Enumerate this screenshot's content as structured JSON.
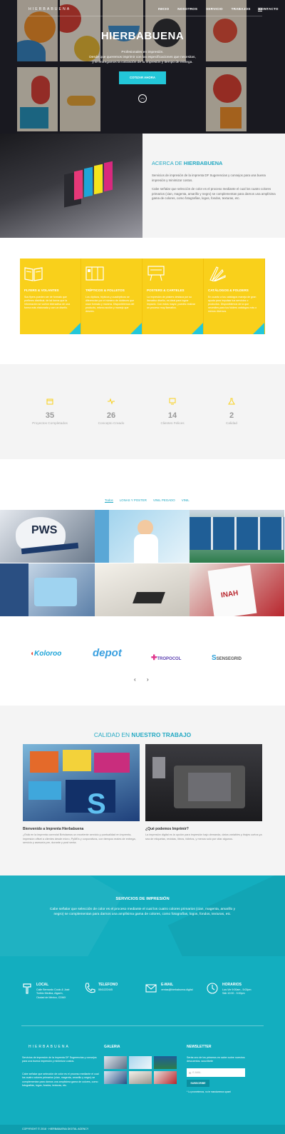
{
  "header": {
    "logo": "HIERBABUENA",
    "nav": [
      "INICIO",
      "NOSOTROS",
      "SERVICIO",
      "TRABAJOS",
      "CONTACTO"
    ]
  },
  "hero": {
    "title": "HIERBABUENA",
    "lines": [
      "Profesionales en impresión.",
      "Desde que queremos imprimir con las especificaciones que necesitas,",
      "y te entregamos la cotización de tu impresión y tiempo de entrega."
    ],
    "cta": "COTIZAR AHORA"
  },
  "about": {
    "title_prefix": "ACERCA DE",
    "title_brand": "HIERBABUENA",
    "p1": "Servicios de impresión de la imprenta DF Sugerencias y consejos para una buena impresión y minimizar costos.",
    "p2": "Cabe señalar que selección de color es el proceso mediante el cual los cuatro colores primarios (cian, magenta, amarillo y negro) se complementan para darnos una amplísima gama de colores, como fotografías, logos, fondos, texturas, etc."
  },
  "services": [
    {
      "title": "FLYERS & VOLANTES",
      "text": "Sus flyers pueden ser de formato que prefieres distribuir, de tal forma que la información se vuelve interactiva de una forma más elaborada y con un diseño."
    },
    {
      "title": "TRÍPTICOS & FOLLETOS",
      "text": "Los dípticos, trípticos y cuadrípticos se diferencian por el número de dobleces que usan formato y manera. Disponiblemos del producto, mismo acción y manejo que desees."
    },
    {
      "title": "POSTERS & CARTELES",
      "text": "La impresión de pósters destaca por su llamativo diseño, es ideal para lograr impacto. Con estos mayor, puedes realizar un proceso muy llamativo."
    },
    {
      "title": "CATÁLOGOS & FOLDERS",
      "text": "En cuanto a tus catálogos maneja de gran ayuda para impulsar tus servicios o productos. Disponiblemos de la que necesites para tus folders catálogos más o menos diversos."
    }
  ],
  "stats": [
    {
      "icon": "calendar-icon",
      "value": "35",
      "label": "Proyectos Completados"
    },
    {
      "icon": "pulse-icon",
      "value": "26",
      "label": "Concepto Creado"
    },
    {
      "icon": "monitor-icon",
      "value": "14",
      "label": "Clientes Felices"
    },
    {
      "icon": "flask-icon",
      "value": "2",
      "label": "Calidad"
    }
  ],
  "portfolio": {
    "tabs": [
      "Todos",
      "LONAS Y POSTER",
      "VINIL PEGADO",
      "VINIL"
    ]
  },
  "brands": [
    "Koloroo",
    "depot",
    "TROPOCOL",
    "SENSEGRID"
  ],
  "quality": {
    "title_prefix": "CALIDAD EN",
    "title_strong": "NUESTRO TRABAJO",
    "left_head": "Bienvenido a Imprenta Hierbabuena",
    "left_text": "¿Está en la imprenta correcta! Brindamos un excelente servicio y puntualidad en imprenta, impresión offset a clientes desde micro, PyMEs y corporativos, con tiempos reales de entrega, servicio y asesoría pre, durante y post venta.",
    "right_head": "¿Qué podemos Imprimir?",
    "right_text": "La impresión digital es la opción para impresión bajo demanda, datos variables y tirajes cortos ya sea de etiquetas, revistas, libros, folletos, y menus solo por citar algunos."
  },
  "impresion": {
    "title": "SERVICIOS DE IMPRESIÓN",
    "text": "Cabe señalar que selección de color es el proceso mediante el cual los cuatro colores primarios (cian, magenta, amarillo y negro) se complementan para darnos una amplísima gama de colores, como fotografías, logos, fondos, texturas, etc."
  },
  "contact": [
    {
      "icon": "pin-icon",
      "title": "LOCAL",
      "lines": [
        "Calle Bernardo Couto & José",
        "Toribio Medina, Algarín,",
        "Ciudad de México, CDMX"
      ]
    },
    {
      "icon": "phone-icon",
      "title": "TELEFONO",
      "lines": [
        "5541222445"
      ]
    },
    {
      "icon": "mail-icon",
      "title": "E-MAIL",
      "lines": [
        "ventas@hierbabuena.digital"
      ]
    },
    {
      "icon": "clock-icon",
      "title": "HORARIOS",
      "lines": [
        "Lun-Vie 9:00am - 5:00pm",
        "Sáb 10:00 - 5:00pm"
      ]
    }
  ],
  "footer": {
    "logo": "HIERBABUENA",
    "about1": "Servicios de impresión de la imprenta DF Sugerencias y consejos para una buena impresión y minimizar costos.",
    "about2": "Cabe señalar que selección de color es el proceso mediante el cual los cuatro colores primarios (cian, magenta, amarillo y negro) se complementan para darnos una amplísima gama de colores, como fotografías, logos, fondos, texturas, etc.",
    "gallery_title": "GALERIA",
    "news_title": "NEWSLETTER",
    "news_text": "Serás uno de los primeros en saber sobre nuestros descuentos. suscríbete",
    "email_placeholder": "E-MAIL",
    "subscribe": "SUBSCRIBE",
    "privacy": "* Lo prometemos, no te mandaremos spam!",
    "copyright": "COPYRIGHT © 2018 · HIERBABUENA DIGITAL AGENCY"
  },
  "colors": {
    "accent": "#23a9c3",
    "yellow": "#f9d01b",
    "teal": "#13aebf"
  }
}
